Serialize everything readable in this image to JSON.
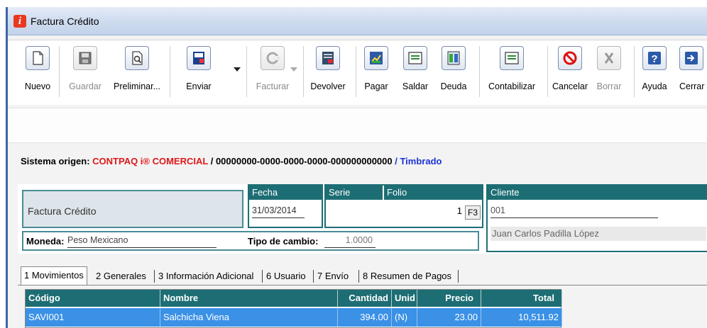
{
  "window": {
    "title": "Factura Crédito"
  },
  "toolbar": {
    "nuevo": "Nuevo",
    "guardar": "Guardar",
    "preliminar": "Preliminar...",
    "enviar": "Enviar",
    "facturar": "Facturar",
    "devolver": "Devolver",
    "pagar": "Pagar",
    "saldar": "Saldar",
    "deuda": "Deuda",
    "contabilizar": "Contabilizar",
    "cancelar": "Cancelar",
    "borrar": "Borrar",
    "ayuda": "Ayuda",
    "cerrar": "Cerrar"
  },
  "origin": {
    "label": "Sistema origen:",
    "system": "CONTPAQ i® COMERCIAL",
    "uuid": "/ 00000000-0000-0000-0000-000000000000",
    "status": "/ Timbrado"
  },
  "document": {
    "type": "Factura Crédito",
    "fecha_label": "Fecha",
    "fecha": "31/03/2014",
    "serie_label": "Serie",
    "folio_label": "Folio",
    "folio": "1",
    "f3": "F3",
    "cliente_label": "Cliente",
    "cliente_code": "001",
    "cliente_name": "Juan Carlos Padilla López",
    "moneda_label": "Moneda:",
    "moneda": "Peso Mexicano",
    "tipo_cambio_label": "Tipo de cambio:",
    "tipo_cambio": "1.0000"
  },
  "tabs": [
    {
      "label": "1 Movimientos"
    },
    {
      "label": "2 Generales"
    },
    {
      "label": "3 Información Adicional"
    },
    {
      "label": "6 Usuario"
    },
    {
      "label": "7 Envío"
    },
    {
      "label": "8 Resumen de Pagos"
    }
  ],
  "grid": {
    "headers": [
      "Código",
      "Nombre",
      "Cantidad",
      "Unid",
      "Precio",
      "Total"
    ],
    "rows": [
      {
        "codigo": "SAVI001",
        "nombre": "Salchicha Viena",
        "cantidad": "394.00",
        "unidad": "(N)",
        "precio": "23.00",
        "total": "10,511.92"
      }
    ]
  },
  "colors": {
    "header_teal": "#1d6e74",
    "selected_row": "#3a91e6",
    "origin_red": "#e01818",
    "origin_blue": "#1a33d6"
  }
}
